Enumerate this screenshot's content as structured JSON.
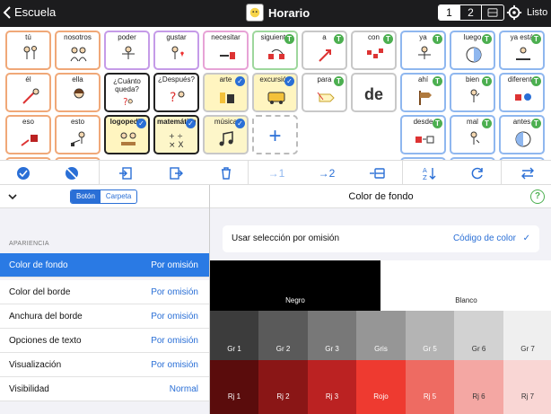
{
  "topbar": {
    "back_label": "Escuela",
    "title": "Horario",
    "pages": [
      "1",
      "2"
    ],
    "done_label": "Listo"
  },
  "grid": {
    "row1": [
      "tú",
      "nosotros",
      "poder",
      "gustar",
      "necesitar",
      "siguiente",
      "a",
      "con",
      "ya",
      "luego",
      "ya está"
    ],
    "row2": [
      "él",
      "ella",
      "¿Cuánto queda?",
      "¿Después?",
      "arte",
      "excursión",
      "para",
      "de",
      "ahí",
      "bien",
      "diferente"
    ],
    "row3": [
      "eso",
      "esto",
      "logopedia",
      "matemáticas",
      "música",
      "desde",
      "mal",
      "antes"
    ],
    "big_letters": {
      "a": "a",
      "de": "de"
    }
  },
  "toolbar": {
    "labels": [
      "→1",
      "→2"
    ]
  },
  "left": {
    "mode_boton": "Botón",
    "mode_carpeta": "Carpeta",
    "section": "APARIENCIA",
    "props": [
      {
        "k": "Color de fondo",
        "v": "Por omisión"
      },
      {
        "k": "Color del borde",
        "v": "Por omisión"
      },
      {
        "k": "Anchura del borde",
        "v": "Por omisión"
      },
      {
        "k": "Opciones de texto",
        "v": "Por omisión"
      },
      {
        "k": "Visualización",
        "v": "Por omisión"
      },
      {
        "k": "Visibilidad",
        "v": "Normal"
      }
    ]
  },
  "right": {
    "title": "Color de fondo",
    "default_label": "Usar selección por omisión",
    "default_value": "Código de color",
    "swatches_row1": [
      {
        "name": "Negro",
        "color": "#000000"
      },
      {
        "name": "Blanco",
        "color": "#ffffff"
      }
    ],
    "swatches_row2": [
      {
        "name": "Gr 1",
        "color": "#3c3c3c"
      },
      {
        "name": "Gr 2",
        "color": "#5a5a5a"
      },
      {
        "name": "Gr 3",
        "color": "#787878"
      },
      {
        "name": "Gris",
        "color": "#969696"
      },
      {
        "name": "Gr 5",
        "color": "#b4b4b4"
      },
      {
        "name": "Gr 6",
        "color": "#d2d2d2"
      },
      {
        "name": "Gr 7",
        "color": "#efefef"
      }
    ],
    "swatches_row3": [
      {
        "name": "Rj 1",
        "color": "#5a0c0c"
      },
      {
        "name": "Rj 2",
        "color": "#8a1616"
      },
      {
        "name": "Rj 3",
        "color": "#bb2222"
      },
      {
        "name": "Rojo",
        "color": "#ee3a30"
      },
      {
        "name": "Rj 5",
        "color": "#ee6b62"
      },
      {
        "name": "Rj 6",
        "color": "#f4a7a3"
      },
      {
        "name": "Rj 7",
        "color": "#f9d6d4"
      }
    ]
  },
  "colors": {
    "accent": "#2a6fd6",
    "selected_row": "#2a7ae4",
    "border_orange": "#f0a878",
    "border_pink": "#e7a3d6",
    "border_purple": "#c59be8",
    "border_green": "#9ed79d",
    "border_gray": "#c8c8c8",
    "border_blue": "#8fb7ef",
    "fill_yellow": "#fff5c0",
    "fill_light_yellow": "#fdf6c9"
  }
}
